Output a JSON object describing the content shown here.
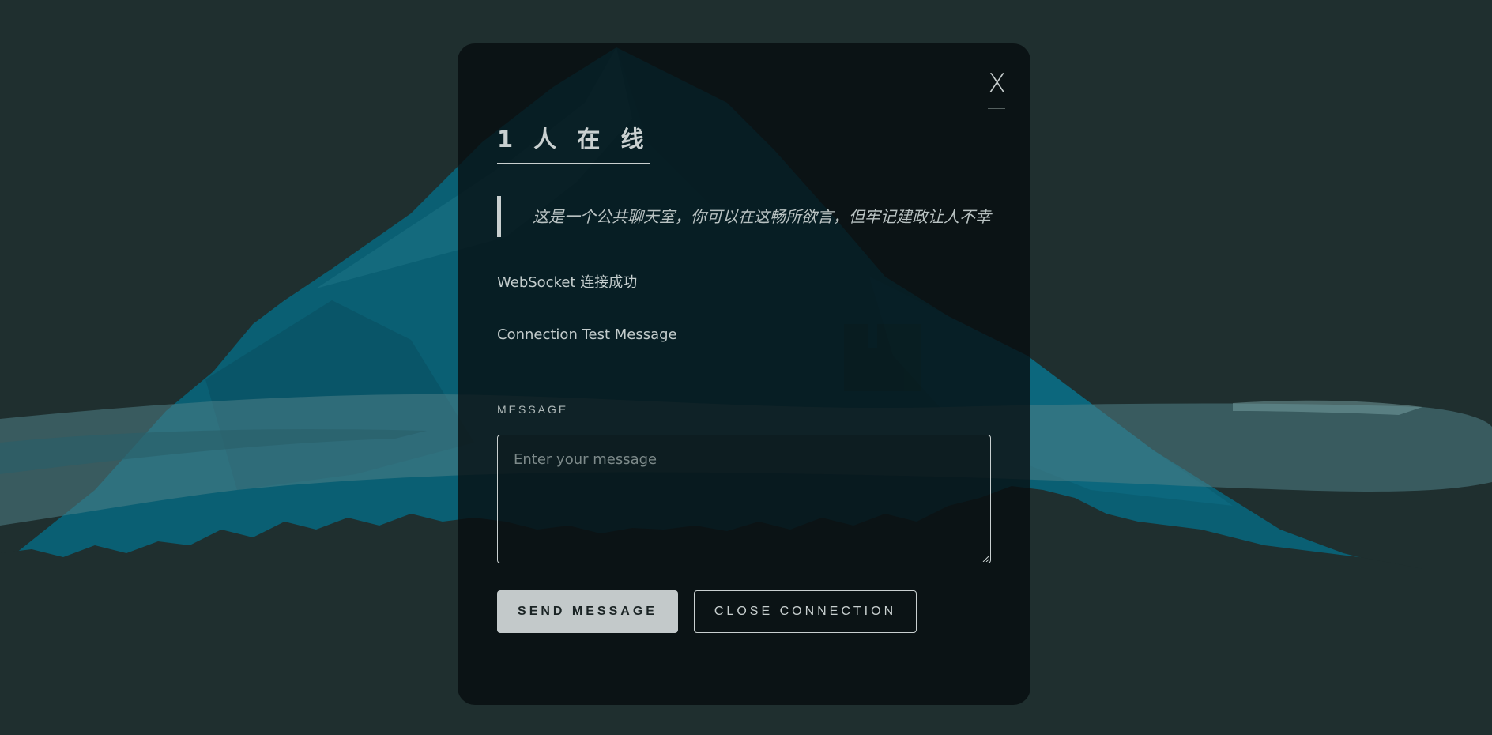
{
  "chat": {
    "online_title": "1 人 在 线",
    "notice": "这是一个公共聊天室，你可以在这畅所欲言，但牢记建政让人不幸",
    "messages": [
      "WebSocket 连接成功",
      "Connection Test Message"
    ],
    "close_label": "X",
    "message_label": "MESSAGE",
    "input_placeholder": "Enter your message",
    "input_value": "",
    "send_label": "SEND MESSAGE",
    "close_connection_label": "CLOSE CONNECTION"
  },
  "colors": {
    "background": "#1f2f2f",
    "mountain": "#0d6a80",
    "panel": "#060c0e",
    "text": "#c9d0d0",
    "send_button_bg": "#c3c9ca"
  },
  "icons": {
    "close": "close-icon",
    "resize": "resize-grip-icon"
  }
}
